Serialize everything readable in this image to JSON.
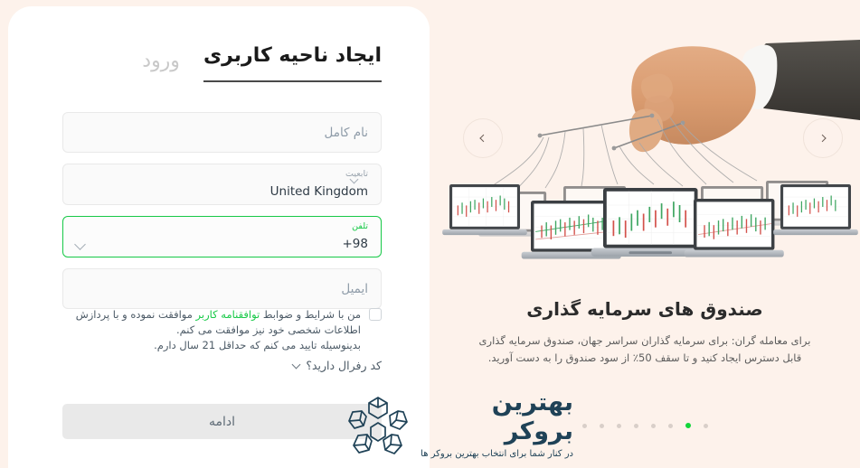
{
  "theme": {
    "page_bg": "#FDF2EB",
    "card_bg": "#FFFFFF",
    "accent_green": "#17C947",
    "dot_active": "#12D63A",
    "logo_navy": "#1F4257",
    "input_bg": "#FAFAFA",
    "button_bg": "#E9E9E9"
  },
  "auth": {
    "tabs": [
      {
        "id": "register",
        "label": "ایجاد ناحیه کاربری",
        "active": true
      },
      {
        "id": "login",
        "label": "ورود",
        "active": false
      }
    ],
    "fields": {
      "fullname": {
        "placeholder": "نام کامل",
        "value": ""
      },
      "nationality": {
        "label": "تابعیت",
        "value": "United Kingdom",
        "chevron": "chevron-down-icon"
      },
      "phone": {
        "label": "تلفن",
        "value": "+98",
        "chevron": "chevron-down-icon",
        "focused": true
      },
      "email": {
        "placeholder": "ایمیل",
        "value": ""
      }
    },
    "terms": {
      "checked": false,
      "text_before": "من با شرایط و ضوابط ",
      "link_text": "توافقنامه کاربر",
      "text_after": " موافقت نموده و با پردازش اطلاعات شخصی خود نیز موافقت می کنم.",
      "line2": "بدینوسیله تایید می کنم که حداقل 21 سال دارم."
    },
    "referral": {
      "label": "کد رفرال دارید؟",
      "chevron": "chevron-down-icon"
    },
    "submit": {
      "label": "ادامه"
    }
  },
  "hero": {
    "title": "صندوق های سرمایه گذاری",
    "description": "برای معامله گران: برای سرمایه گذاران سراسر جهان، صندوق سرمایه گذاری قابل دسترس ایجاد کنید و تا سقف 50٪ از سود صندوق را به دست آورید.",
    "illustration": "hand-puppeteer-controlling-trading-laptops",
    "prev_arrow": "chevron-left-icon",
    "next_arrow": "chevron-right-icon",
    "dots": {
      "count": 8,
      "active_index": 1
    }
  },
  "watermark": {
    "title": "بهترین بروکر",
    "subtitle": "در کنار شما برای انتخاب بهترین بروکر ها",
    "mark": "cube-star-logo-icon"
  }
}
